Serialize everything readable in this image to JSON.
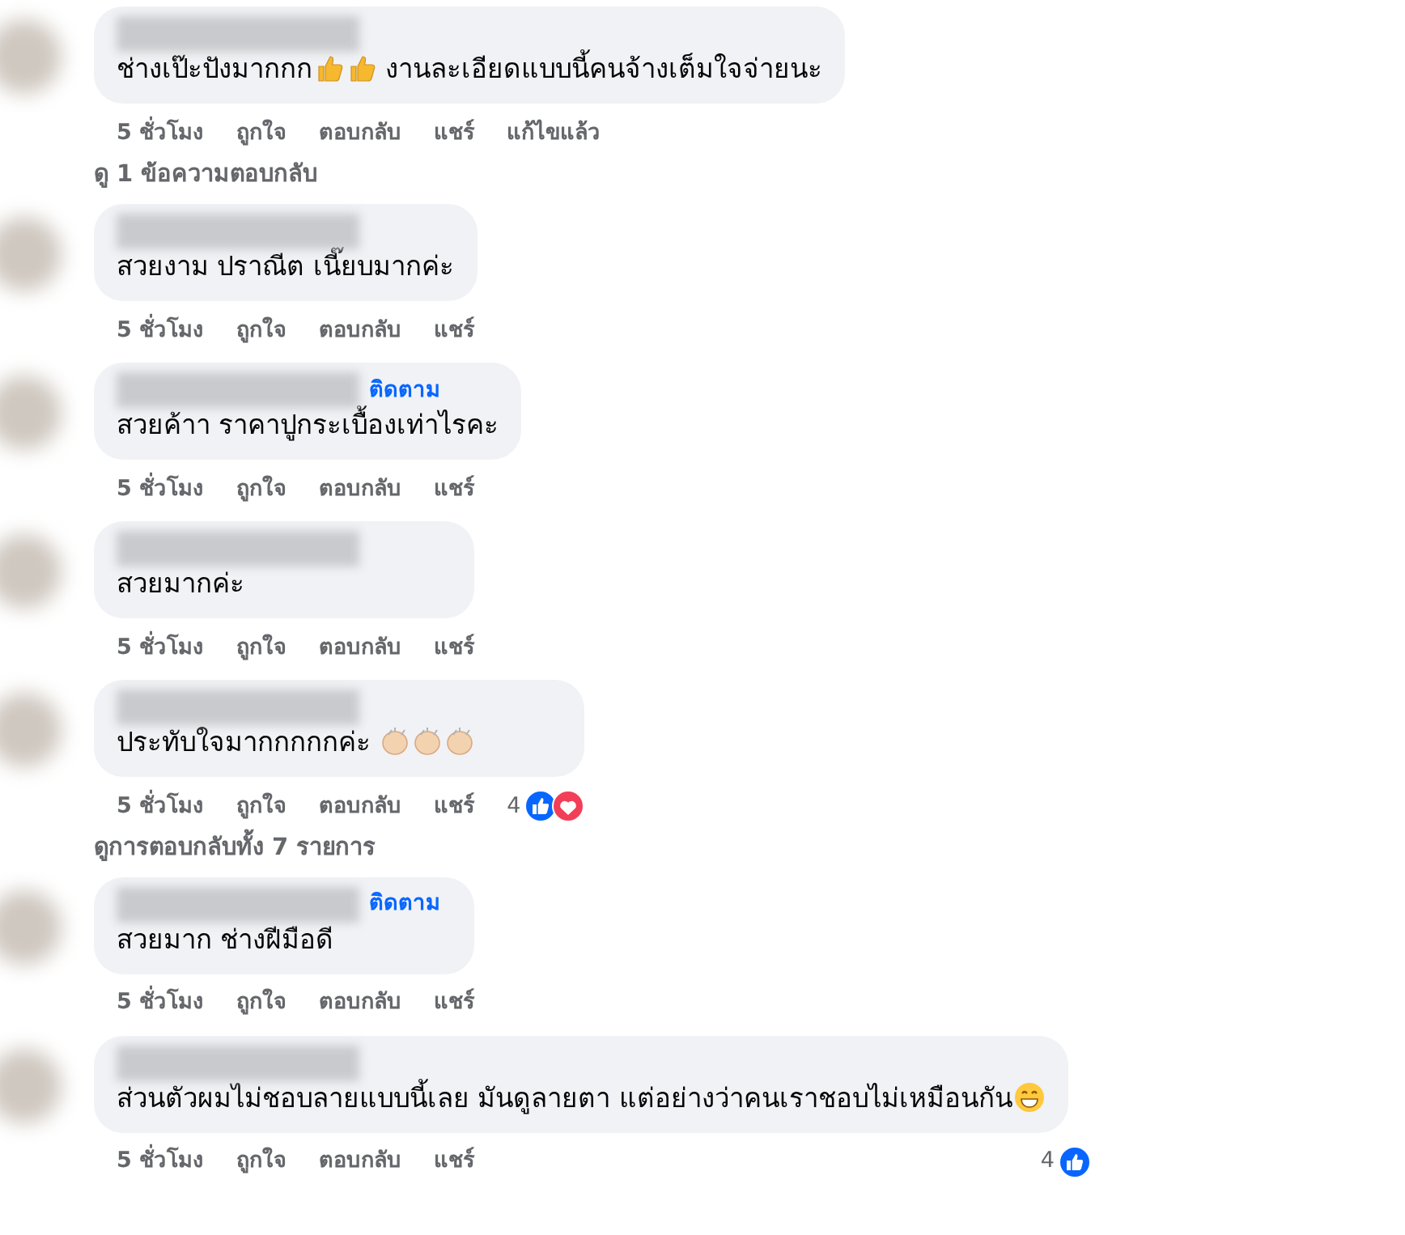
{
  "comments": [
    {
      "body": [
        {
          "kind": "text",
          "text": "ช่างเป๊ะปังมากกก"
        },
        {
          "kind": "thumbs"
        },
        {
          "kind": "thumbs"
        },
        {
          "kind": "text",
          "text": " งานละเอียดแบบนี้คนจ้างเต็มใจจ่ายนะ"
        }
      ],
      "actions": [
        "5 ชั่วโมง",
        "ถูกใจ",
        "ตอบกลับ",
        "แชร์",
        "แก้ไขแล้ว"
      ],
      "more_replies": "ดู 1 ข้อความตอบกลับ"
    },
    {
      "body": [
        {
          "kind": "text",
          "text": "สวยงาม ปราณีต เนี๊ยบมากค่ะ"
        }
      ],
      "actions": [
        "5 ชั่วโมง",
        "ถูกใจ",
        "ตอบกลับ",
        "แชร์"
      ]
    },
    {
      "follow": "ติดตาม",
      "body": [
        {
          "kind": "text",
          "text": "สวยค้าา ราคาปูกระเบื้องเท่าไรคะ"
        }
      ],
      "actions": [
        "5 ชั่วโมง",
        "ถูกใจ",
        "ตอบกลับ",
        "แชร์"
      ]
    },
    {
      "body": [
        {
          "kind": "text",
          "text": "สวยมากค่ะ"
        }
      ],
      "actions": [
        "5 ชั่วโมง",
        "ถูกใจ",
        "ตอบกลับ",
        "แชร์"
      ]
    },
    {
      "body": [
        {
          "kind": "text",
          "text": "ประทับใจมากกกกกค่ะ "
        },
        {
          "kind": "clap"
        },
        {
          "kind": "clap"
        },
        {
          "kind": "clap"
        }
      ],
      "actions": [
        "5 ชั่วโมง",
        "ถูกใจ",
        "ตอบกลับ",
        "แชร์"
      ],
      "reactions": {
        "kind": "inline",
        "count": "4",
        "like": true,
        "love": true
      },
      "more_replies": "ดูการตอบกลับทั้ง 7 รายการ"
    },
    {
      "follow": "ติดตาม",
      "body": [
        {
          "kind": "text",
          "text": "สวยมาก ช่างฝีมือดี"
        }
      ],
      "actions": [
        "5 ชั่วโมง",
        "ถูกใจ",
        "ตอบกลับ",
        "แชร์"
      ]
    },
    {
      "body": [
        {
          "kind": "text",
          "text": "ส่วนตัวผมไม่ชอบลายแบบนี้เลย มันดูลายตา แต่อย่างว่าคนเราชอบไม่เหมือนกัน"
        },
        {
          "kind": "grin"
        }
      ],
      "actions": [
        "5 ชั่วโมง",
        "ถูกใจ",
        "ตอบกลับ",
        "แชร์"
      ],
      "reactions": {
        "kind": "right",
        "count": "4",
        "like": true,
        "love": false
      }
    }
  ]
}
